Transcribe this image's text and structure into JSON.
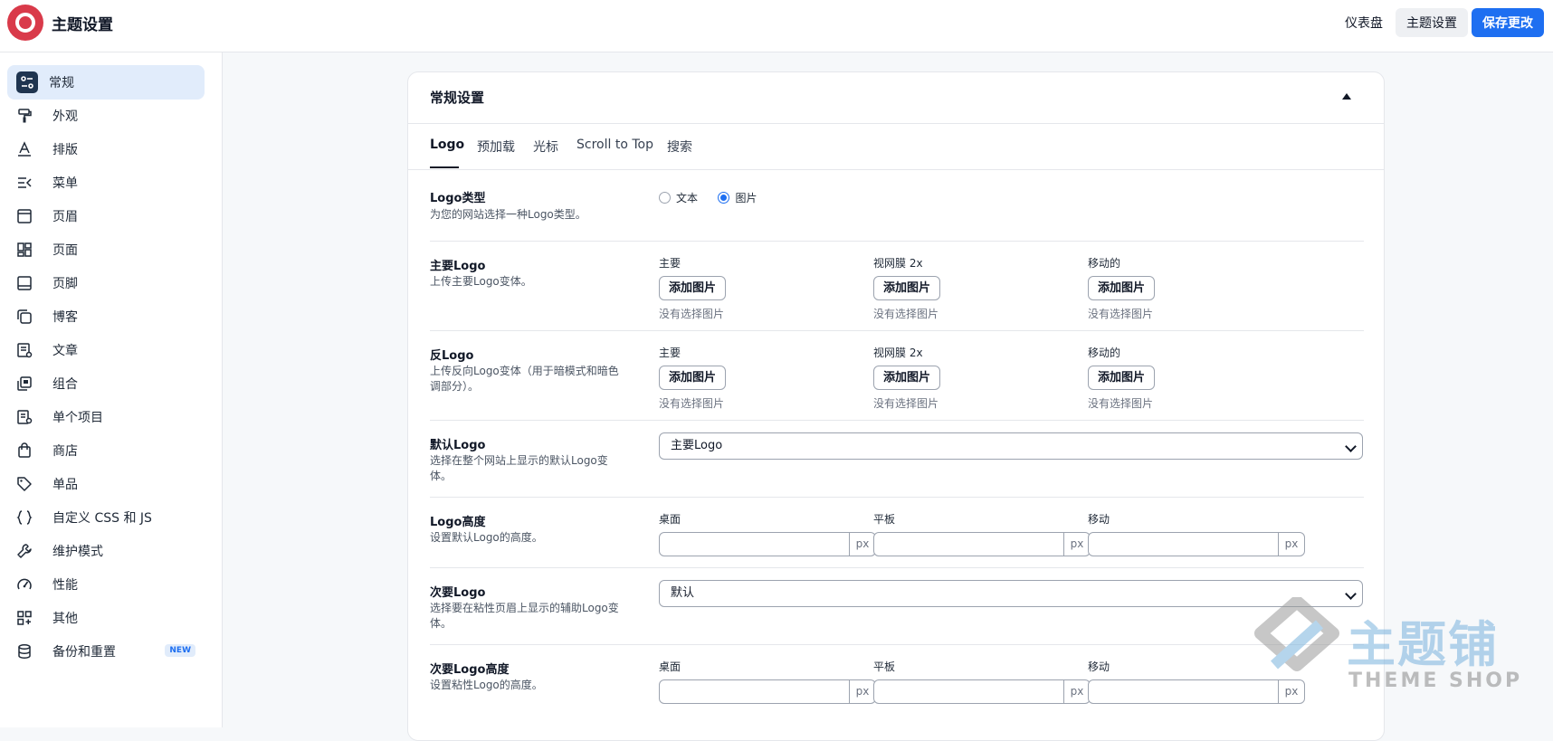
{
  "header": {
    "title": "主题设置",
    "dashboard_link": "仪表盘",
    "theme_settings_button": "主题设置",
    "save_button": "保存更改"
  },
  "sidebar": {
    "items": [
      {
        "label": "常规",
        "icon": "general-icon",
        "active": true
      },
      {
        "label": "外观",
        "icon": "paint-roller-icon"
      },
      {
        "label": "排版",
        "icon": "typography-icon"
      },
      {
        "label": "菜单",
        "icon": "menu-icon"
      },
      {
        "label": "页眉",
        "icon": "header-icon"
      },
      {
        "label": "页面",
        "icon": "page-grid-icon"
      },
      {
        "label": "页脚",
        "icon": "footer-icon"
      },
      {
        "label": "博客",
        "icon": "blog-icon"
      },
      {
        "label": "文章",
        "icon": "article-icon"
      },
      {
        "label": "组合",
        "icon": "portfolio-icon"
      },
      {
        "label": "单个项目",
        "icon": "single-item-icon"
      },
      {
        "label": "商店",
        "icon": "shop-bag-icon"
      },
      {
        "label": "单品",
        "icon": "tag-icon"
      },
      {
        "label": "自定义 CSS 和 JS",
        "icon": "code-icon"
      },
      {
        "label": "维护模式",
        "icon": "wrench-icon"
      },
      {
        "label": "性能",
        "icon": "gauge-icon"
      },
      {
        "label": "其他",
        "icon": "grid-plus-icon"
      },
      {
        "label": "备份和重置",
        "icon": "database-icon",
        "badge": "NEW"
      }
    ]
  },
  "panel": {
    "title": "常规设置",
    "tabs": [
      "Logo",
      "预加载",
      "光标",
      "Scroll to Top",
      "搜索"
    ],
    "active_tab": "Logo"
  },
  "settings": {
    "logo_type": {
      "title": "Logo类型",
      "desc": "为您的网站选择一种Logo类型。",
      "options": [
        "文本",
        "图片"
      ],
      "selected": "图片"
    },
    "main_logo": {
      "title": "主要Logo",
      "desc": "上传主要Logo变体。",
      "columns": [
        {
          "label": "主要",
          "button": "添加图片",
          "status": "没有选择图片"
        },
        {
          "label": "视网膜 2x",
          "button": "添加图片",
          "status": "没有选择图片"
        },
        {
          "label": "移动的",
          "button": "添加图片",
          "status": "没有选择图片"
        }
      ]
    },
    "inverse_logo": {
      "title": "反Logo",
      "desc": "上传反向Logo变体（用于暗模式和暗色调部分）。",
      "columns": [
        {
          "label": "主要",
          "button": "添加图片",
          "status": "没有选择图片"
        },
        {
          "label": "视网膜 2x",
          "button": "添加图片",
          "status": "没有选择图片"
        },
        {
          "label": "移动的",
          "button": "添加图片",
          "status": "没有选择图片"
        }
      ]
    },
    "default_logo": {
      "title": "默认Logo",
      "desc": "选择在整个网站上显示的默认Logo变体。",
      "value": "主要Logo"
    },
    "logo_height": {
      "title": "Logo高度",
      "desc": "设置默认Logo的高度。",
      "columns": [
        {
          "label": "桌面",
          "value": "",
          "unit": "px"
        },
        {
          "label": "平板",
          "value": "",
          "unit": "px"
        },
        {
          "label": "移动",
          "value": "",
          "unit": "px"
        }
      ]
    },
    "secondary_logo": {
      "title": "次要Logo",
      "desc": "选择要在粘性页眉上显示的辅助Logo变体。",
      "value": "默认"
    },
    "secondary_logo_height": {
      "title": "次要Logo高度",
      "desc": "设置粘性Logo的高度。",
      "columns": [
        {
          "label": "桌面",
          "unit": "px"
        },
        {
          "label": "平板",
          "unit": "px"
        },
        {
          "label": "移动",
          "unit": "px"
        }
      ]
    }
  },
  "watermark": {
    "text": "主题铺",
    "sub": "THEME SHOP"
  },
  "colors": {
    "accent": "#1e6ff1",
    "active_bg": "#e1ecfb",
    "brand": "#d93a4a"
  }
}
